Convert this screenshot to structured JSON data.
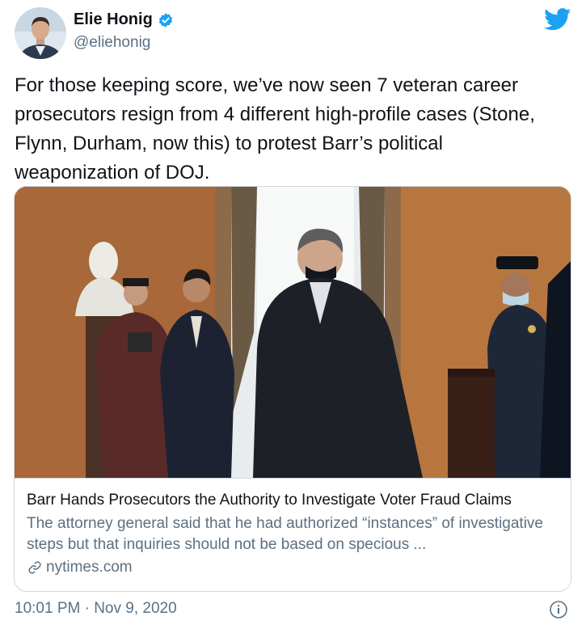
{
  "author": {
    "display_name": "Elie Honig",
    "handle": "@eliehonig",
    "verified_icon": "verified-badge-icon",
    "avatar": "avatar"
  },
  "brand": {
    "icon": "twitter-bird-icon",
    "color": "#1da1f2"
  },
  "tweet": {
    "text": "For those keeping score, we’ve now seen 7 veteran career prosecutors resign from 4 different high-profile cases (Stone, Flynn, Durham, now this) to protest Barr’s political weaponization of DOJ."
  },
  "card": {
    "title": "Barr Hands Prosecutors the Authority to Investigate Voter Fraud Claims",
    "description": "The attorney general said that he had authorized “instances” of investigative steps but that inquiries should not be based on specious ...",
    "domain": "nytimes.com",
    "link_icon": "link-icon"
  },
  "footer": {
    "timestamp": "10:01 PM · Nov 9, 2020",
    "info_icon": "info-icon"
  },
  "colors": {
    "text_primary": "#0f1419",
    "text_secondary": "#5b7083",
    "border": "#cfd9de",
    "accent": "#1da1f2"
  }
}
